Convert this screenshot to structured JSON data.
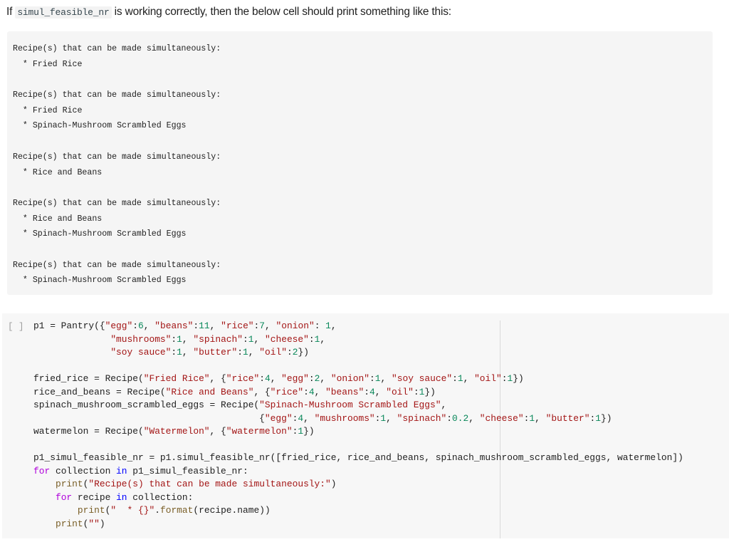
{
  "intro": {
    "prefix": "If ",
    "code": "simul_feasible_nr",
    "suffix": " is working correctly, then the below cell should print something like this:"
  },
  "expected_output": {
    "groups": [
      {
        "header": "Recipe(s) that can be made simultaneously:",
        "items": [
          "  * Fried Rice"
        ]
      },
      {
        "header": "Recipe(s) that can be made simultaneously:",
        "items": [
          "  * Fried Rice",
          "  * Spinach-Mushroom Scrambled Eggs"
        ]
      },
      {
        "header": "Recipe(s) that can be made simultaneously:",
        "items": [
          "  * Rice and Beans"
        ]
      },
      {
        "header": "Recipe(s) that can be made simultaneously:",
        "items": [
          "  * Rice and Beans",
          "  * Spinach-Mushroom Scrambled Eggs"
        ]
      },
      {
        "header": "Recipe(s) that can be made simultaneously:",
        "items": [
          "  * Spinach-Mushroom Scrambled Eggs"
        ]
      }
    ]
  },
  "code_cell": {
    "run_indicator": "[ ]",
    "lines": [
      [
        [
          "plain",
          "p1 = Pantry({"
        ],
        [
          "str",
          "\"egg\""
        ],
        [
          "plain",
          ":"
        ],
        [
          "num",
          "6"
        ],
        [
          "plain",
          ", "
        ],
        [
          "str",
          "\"beans\""
        ],
        [
          "plain",
          ":"
        ],
        [
          "num",
          "11"
        ],
        [
          "plain",
          ", "
        ],
        [
          "str",
          "\"rice\""
        ],
        [
          "plain",
          ":"
        ],
        [
          "num",
          "7"
        ],
        [
          "plain",
          ", "
        ],
        [
          "str",
          "\"onion\""
        ],
        [
          "plain",
          ": "
        ],
        [
          "num",
          "1"
        ],
        [
          "plain",
          ","
        ]
      ],
      [
        [
          "plain",
          "              "
        ],
        [
          "str",
          "\"mushrooms\""
        ],
        [
          "plain",
          ":"
        ],
        [
          "num",
          "1"
        ],
        [
          "plain",
          ", "
        ],
        [
          "str",
          "\"spinach\""
        ],
        [
          "plain",
          ":"
        ],
        [
          "num",
          "1"
        ],
        [
          "plain",
          ", "
        ],
        [
          "str",
          "\"cheese\""
        ],
        [
          "plain",
          ":"
        ],
        [
          "num",
          "1"
        ],
        [
          "plain",
          ","
        ]
      ],
      [
        [
          "plain",
          "              "
        ],
        [
          "str",
          "\"soy sauce\""
        ],
        [
          "plain",
          ":"
        ],
        [
          "num",
          "1"
        ],
        [
          "plain",
          ", "
        ],
        [
          "str",
          "\"butter\""
        ],
        [
          "plain",
          ":"
        ],
        [
          "num",
          "1"
        ],
        [
          "plain",
          ", "
        ],
        [
          "str",
          "\"oil\""
        ],
        [
          "plain",
          ":"
        ],
        [
          "num",
          "2"
        ],
        [
          "plain",
          "})"
        ]
      ],
      [],
      [
        [
          "plain",
          "fried_rice = Recipe("
        ],
        [
          "str",
          "\"Fried Rice\""
        ],
        [
          "plain",
          ", {"
        ],
        [
          "str",
          "\"rice\""
        ],
        [
          "plain",
          ":"
        ],
        [
          "num",
          "4"
        ],
        [
          "plain",
          ", "
        ],
        [
          "str",
          "\"egg\""
        ],
        [
          "plain",
          ":"
        ],
        [
          "num",
          "2"
        ],
        [
          "plain",
          ", "
        ],
        [
          "str",
          "\"onion\""
        ],
        [
          "plain",
          ":"
        ],
        [
          "num",
          "1"
        ],
        [
          "plain",
          ", "
        ],
        [
          "str",
          "\"soy sauce\""
        ],
        [
          "plain",
          ":"
        ],
        [
          "num",
          "1"
        ],
        [
          "plain",
          ", "
        ],
        [
          "str",
          "\"oil\""
        ],
        [
          "plain",
          ":"
        ],
        [
          "num",
          "1"
        ],
        [
          "plain",
          "})"
        ]
      ],
      [
        [
          "plain",
          "rice_and_beans = Recipe("
        ],
        [
          "str",
          "\"Rice and Beans\""
        ],
        [
          "plain",
          ", {"
        ],
        [
          "str",
          "\"rice\""
        ],
        [
          "plain",
          ":"
        ],
        [
          "num",
          "4"
        ],
        [
          "plain",
          ", "
        ],
        [
          "str",
          "\"beans\""
        ],
        [
          "plain",
          ":"
        ],
        [
          "num",
          "4"
        ],
        [
          "plain",
          ", "
        ],
        [
          "str",
          "\"oil\""
        ],
        [
          "plain",
          ":"
        ],
        [
          "num",
          "1"
        ],
        [
          "plain",
          "})"
        ]
      ],
      [
        [
          "plain",
          "spinach_mushroom_scrambled_eggs = Recipe("
        ],
        [
          "str",
          "\"Spinach-Mushroom Scrambled Eggs\""
        ],
        [
          "plain",
          ","
        ]
      ],
      [
        [
          "plain",
          "                                         {"
        ],
        [
          "str",
          "\"egg\""
        ],
        [
          "plain",
          ":"
        ],
        [
          "num",
          "4"
        ],
        [
          "plain",
          ", "
        ],
        [
          "str",
          "\"mushrooms\""
        ],
        [
          "plain",
          ":"
        ],
        [
          "num",
          "1"
        ],
        [
          "plain",
          ", "
        ],
        [
          "str",
          "\"spinach\""
        ],
        [
          "plain",
          ":"
        ],
        [
          "num",
          "0.2"
        ],
        [
          "plain",
          ", "
        ],
        [
          "str",
          "\"cheese\""
        ],
        [
          "plain",
          ":"
        ],
        [
          "num",
          "1"
        ],
        [
          "plain",
          ", "
        ],
        [
          "str",
          "\"butter\""
        ],
        [
          "plain",
          ":"
        ],
        [
          "num",
          "1"
        ],
        [
          "plain",
          "})"
        ]
      ],
      [
        [
          "plain",
          "watermelon = Recipe("
        ],
        [
          "str",
          "\"Watermelon\""
        ],
        [
          "plain",
          ", {"
        ],
        [
          "str",
          "\"watermelon\""
        ],
        [
          "plain",
          ":"
        ],
        [
          "num",
          "1"
        ],
        [
          "plain",
          "})"
        ]
      ],
      [],
      [
        [
          "plain",
          "p1_simul_feasible_nr = p1.simul_feasible_nr([fried_rice, rice_and_beans, spinach_mushroom_scrambled_eggs, watermelon])"
        ]
      ],
      [
        [
          "ctl",
          "for"
        ],
        [
          "plain",
          " collection "
        ],
        [
          "kw",
          "in"
        ],
        [
          "plain",
          " p1_simul_feasible_nr:"
        ]
      ],
      [
        [
          "plain",
          "    "
        ],
        [
          "fn",
          "print"
        ],
        [
          "plain",
          "("
        ],
        [
          "str",
          "\"Recipe(s) that can be made simultaneously:\""
        ],
        [
          "plain",
          ")"
        ]
      ],
      [
        [
          "plain",
          "    "
        ],
        [
          "ctl",
          "for"
        ],
        [
          "plain",
          " recipe "
        ],
        [
          "kw",
          "in"
        ],
        [
          "plain",
          " collection:"
        ]
      ],
      [
        [
          "plain",
          "        "
        ],
        [
          "fn",
          "print"
        ],
        [
          "plain",
          "("
        ],
        [
          "str",
          "\"  * {}\""
        ],
        [
          "plain",
          "."
        ],
        [
          "fn",
          "format"
        ],
        [
          "plain",
          "(recipe.name))"
        ]
      ],
      [
        [
          "plain",
          "    "
        ],
        [
          "fn",
          "print"
        ],
        [
          "plain",
          "("
        ],
        [
          "str",
          "\"\""
        ],
        [
          "plain",
          ")"
        ]
      ]
    ]
  }
}
